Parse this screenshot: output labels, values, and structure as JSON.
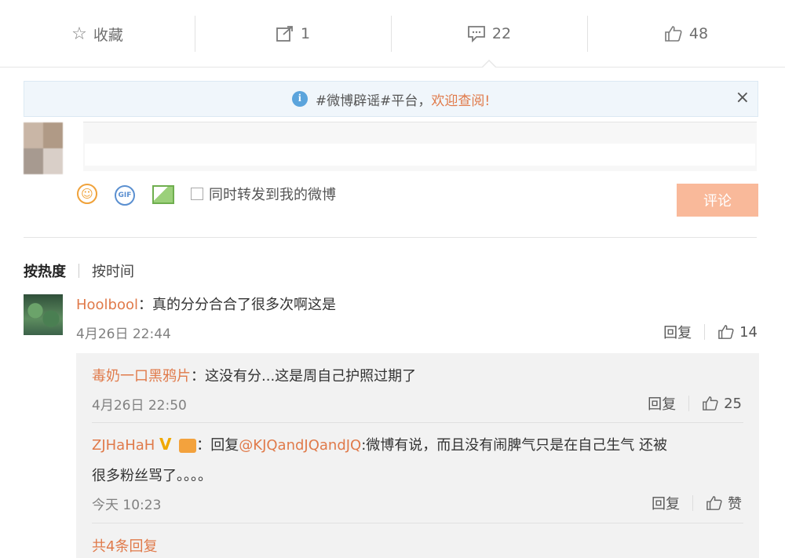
{
  "action_bar": {
    "favorite_label": "收藏",
    "repost_count": "1",
    "comment_count": "22",
    "like_count": "48"
  },
  "notice": {
    "text": "#微博辟谣#平台，",
    "link": "欢迎查阅!",
    "close": "×"
  },
  "composer": {
    "repost_checkbox_label": "同时转发到我的微博",
    "submit_label": "评论",
    "gif_label": "GIF"
  },
  "sort": {
    "by_hot": "按热度",
    "by_time": "按时间"
  },
  "comments": [
    {
      "user": "Hoolbool",
      "text": "：真的分分合合了很多次啊这是",
      "time": "4月26日 22:44",
      "reply_label": "回复",
      "likes": "14"
    }
  ],
  "replies": [
    {
      "user": "毒奶一口黑鸦片",
      "text": "：这没有分...这是周自己护照过期了",
      "time": "4月26日 22:50",
      "reply_label": "回复",
      "likes": "25"
    },
    {
      "user": "ZJHaHaH",
      "verified": "V",
      "text_prefix": "：回复",
      "mention": "@KJQandJQandJQ",
      "text_line1": ":微博有说，而且没有闹脾气只是在自己生气 还被",
      "text_line2": "很多粉丝骂了。。。。",
      "time": "今天 10:23",
      "reply_label": "回复",
      "likes": "赞"
    }
  ],
  "more_replies": "共4条回复",
  "colors": {
    "accent_orange": "#e07a4a",
    "submit_bg": "#f9b99a",
    "notice_bg": "#f0f6fb",
    "info_blue": "#5ba4dc"
  }
}
